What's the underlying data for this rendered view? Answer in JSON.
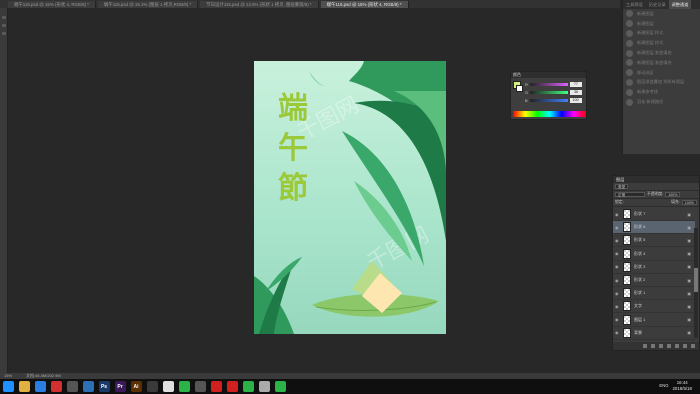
{
  "tabs": [
    {
      "label": "端午115.psd @ 15% (形状 4, RGB/8) *",
      "active": false
    },
    {
      "label": "端午115.psd @ 15.1% (图层 1 拷贝,RGB/8) *",
      "active": false
    },
    {
      "label": "节日设计115.psd @ 12.5% (形状 1 拷贝, 图层蒙版/8) *",
      "active": false
    },
    {
      "label": "端午115.psd @ 15% (形状 4, RGB/8) *",
      "active": true
    }
  ],
  "canvas": {
    "title_chars": [
      "端",
      "午",
      "節"
    ],
    "watermark": "千图网"
  },
  "history_panel": {
    "tabs": [
      "工具预设",
      "历史记录",
      "调整通道",
      "通道"
    ],
    "active_tab": 2,
    "items": [
      "新建图层",
      "新建图层",
      "新建图层 样式",
      "新建图层 样式",
      "新建图层 渐变填充",
      "新建图层 渐变填充",
      "移动选区",
      "图层渐变叠加 到所有图层",
      "新建参考线",
      "羽化 新建路径"
    ]
  },
  "color_panel": {
    "title": "颜色",
    "rows": [
      {
        "label": "R",
        "value": "77",
        "gradient": "#e060ff"
      },
      {
        "label": "G",
        "value": "36",
        "gradient": "#40ff80"
      },
      {
        "label": "B",
        "value": "100",
        "gradient": "#4080ff"
      }
    ],
    "fg_color": "#d0f080",
    "bg_color": "#ffffff"
  },
  "layers_panel": {
    "title": "图层",
    "kind_label": "类型",
    "blend_mode": "正常",
    "opacity_label": "不透明度:",
    "opacity": "100%",
    "lock_label": "锁定:",
    "fill_label": "填充:",
    "fill": "100%",
    "layers": [
      {
        "name": "形状 7",
        "selected": false
      },
      {
        "name": "形状 6",
        "selected": true
      },
      {
        "name": "形状 5",
        "selected": false
      },
      {
        "name": "形状 4",
        "selected": false
      },
      {
        "name": "形状 3",
        "selected": false
      },
      {
        "name": "形状 2",
        "selected": false
      },
      {
        "name": "形状 1",
        "selected": false
      },
      {
        "name": "文字",
        "selected": false
      },
      {
        "name": "图层 1",
        "selected": false
      },
      {
        "name": "背景",
        "selected": false
      }
    ]
  },
  "status_bar": {
    "zoom": "15%",
    "doc": "文档:46.4M/202.9M"
  },
  "taskbar": {
    "apps": [
      {
        "icon": "windows-icon",
        "label": "",
        "color": "#1e90ff"
      },
      {
        "icon": "file-explorer-icon",
        "label": "",
        "color": "#e0b040"
      },
      {
        "icon": "browser-icon",
        "label": "",
        "color": "#2a7de1"
      },
      {
        "icon": "media-icon",
        "label": "",
        "color": "#d03030"
      },
      {
        "icon": "app-icon",
        "label": "",
        "color": "#555"
      },
      {
        "icon": "store-icon",
        "label": "",
        "color": "#2b6fb6"
      },
      {
        "icon": "photoshop-icon",
        "label": "Ps",
        "color": "#1a3a6a"
      },
      {
        "icon": "premiere-icon",
        "label": "Pr",
        "color": "#3a1a5a"
      },
      {
        "icon": "illustrator-icon",
        "label": "Ai",
        "color": "#5a3000"
      },
      {
        "icon": "app2-icon",
        "label": "",
        "color": "#3a3a3a"
      },
      {
        "icon": "chrome-icon",
        "label": "",
        "color": "#e0e0e0"
      },
      {
        "icon": "wechat-icon",
        "label": "",
        "color": "#2bb34a"
      },
      {
        "icon": "app3-icon",
        "label": "",
        "color": "#555"
      },
      {
        "icon": "acrobat-icon",
        "label": "",
        "color": "#d02020"
      },
      {
        "icon": "app4-icon",
        "label": "",
        "color": "#d02020"
      },
      {
        "icon": "app5-icon",
        "label": "",
        "color": "#2bb34a"
      },
      {
        "icon": "app6-icon",
        "label": "",
        "color": "#aaa"
      },
      {
        "icon": "app7-icon",
        "label": "",
        "color": "#2bb34a"
      }
    ],
    "lang": "ENG",
    "time": "16:44",
    "date": "2018/5/18"
  }
}
